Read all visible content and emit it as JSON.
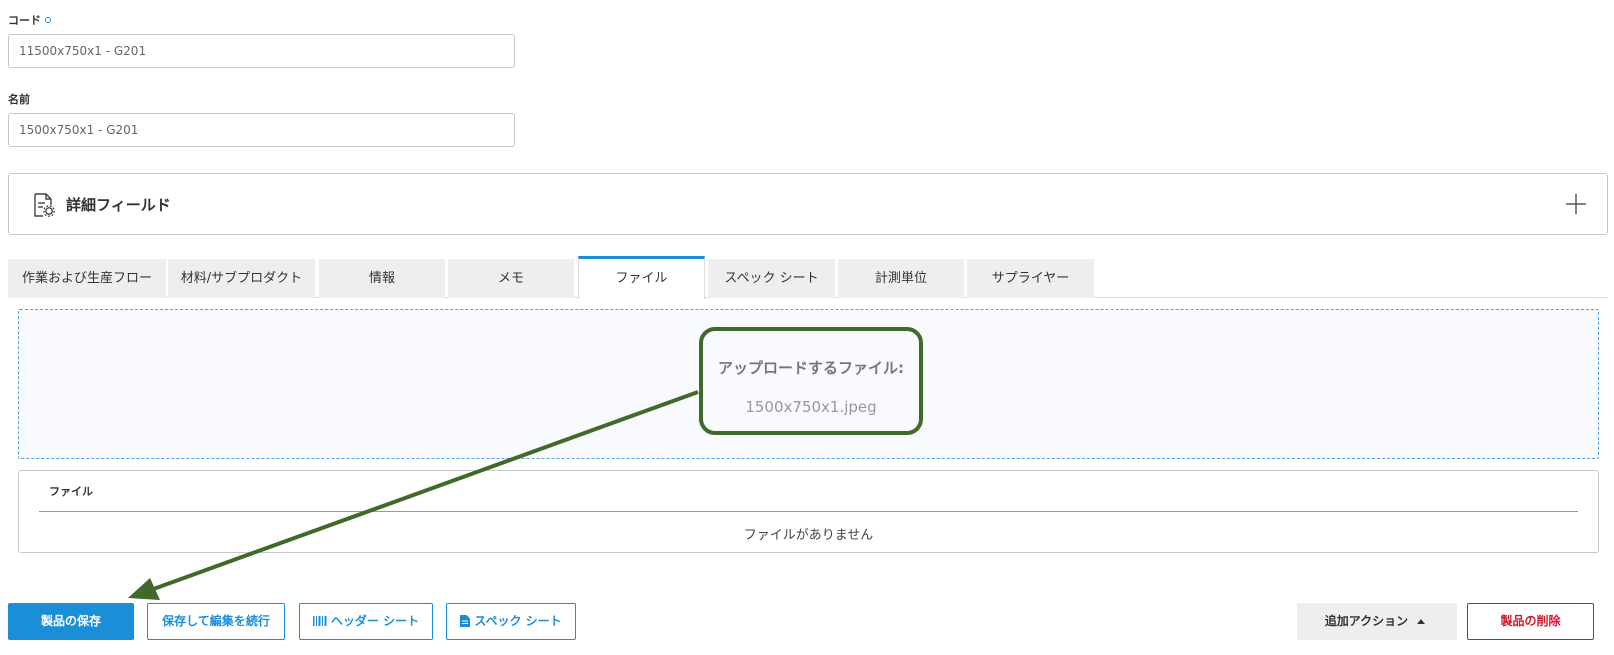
{
  "form": {
    "code_label": "コード",
    "code_value": "11500x750x1 - G201",
    "name_label": "名前",
    "name_value": "1500x750x1 - G201"
  },
  "details": {
    "title": "詳細フィールド",
    "icon": "document-settings-icon",
    "toggle_icon": "plus-icon"
  },
  "tabs": [
    {
      "label": "作業および生産フロー",
      "active": false
    },
    {
      "label": "材料/サブプロダクト",
      "active": false
    },
    {
      "label": "情報",
      "active": false
    },
    {
      "label": "メモ",
      "active": false
    },
    {
      "label": "ファイル",
      "active": true
    },
    {
      "label": "スペック シート",
      "active": false
    },
    {
      "label": "計測単位",
      "active": false
    },
    {
      "label": "サプライヤー",
      "active": false
    }
  ],
  "upload": {
    "title": "アップロードするファイル:",
    "filename": "1500x750x1.jpeg"
  },
  "files": {
    "column_header": "ファイル",
    "empty_text": "ファイルがありません"
  },
  "actions": {
    "save": "製品の保存",
    "save_continue": "保存して編集を続行",
    "header_sheet": "ヘッダー シート",
    "spec_sheet": "スペック シート",
    "more_actions": "追加アクション",
    "delete": "製品の削除"
  },
  "colors": {
    "accent": "#1a8fd8",
    "danger": "#d0192f",
    "annotation": "#41692a"
  }
}
